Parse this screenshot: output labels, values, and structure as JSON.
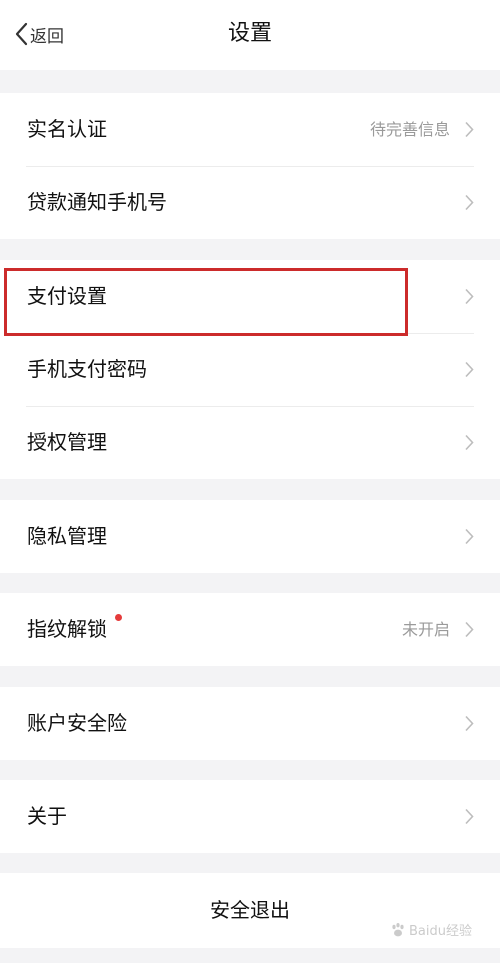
{
  "header": {
    "back_label": "返回",
    "title": "设置"
  },
  "groups": [
    {
      "items": [
        {
          "label": "实名认证",
          "value": "待完善信息"
        },
        {
          "label": "贷款通知手机号",
          "value": ""
        }
      ]
    },
    {
      "items": [
        {
          "label": "支付设置",
          "value": ""
        },
        {
          "label": "手机支付密码",
          "value": ""
        },
        {
          "label": "授权管理",
          "value": ""
        }
      ]
    },
    {
      "items": [
        {
          "label": "隐私管理",
          "value": ""
        }
      ]
    },
    {
      "items": [
        {
          "label": "指纹解锁",
          "value": "未开启"
        }
      ]
    },
    {
      "items": [
        {
          "label": "账户安全险",
          "value": ""
        }
      ]
    },
    {
      "items": [
        {
          "label": "关于",
          "value": ""
        }
      ]
    }
  ],
  "logout_label": "安全退出",
  "watermark": "Baidu经验",
  "colors": {
    "background": "#f3f3f5",
    "highlight_border": "#cc2b2b",
    "notification_dot": "#e53b3b",
    "secondary_text": "#9a9a9a"
  },
  "icons": [
    "chevron-left-icon",
    "chevron-right-icon",
    "notification-dot"
  ]
}
